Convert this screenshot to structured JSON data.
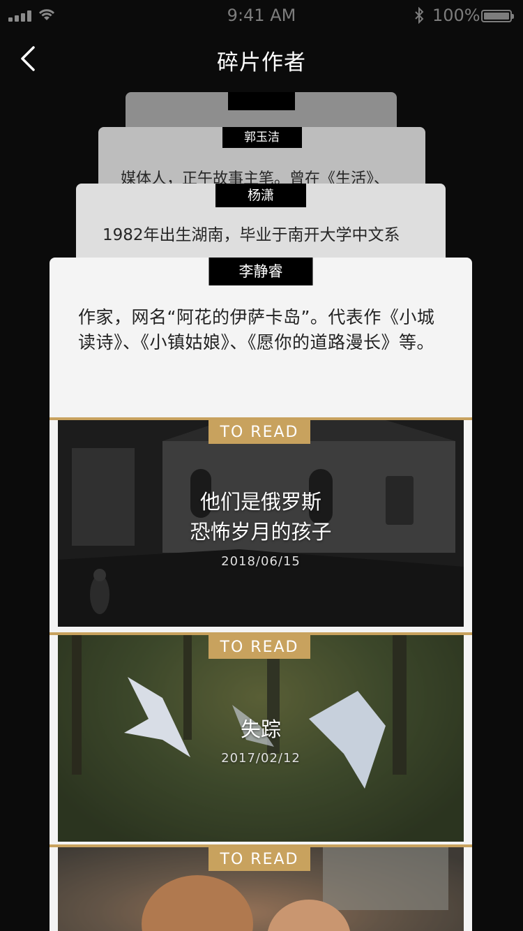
{
  "status_bar": {
    "time": "9:41 AM",
    "battery_percent": "100%",
    "signal_bars": 4,
    "battery_level": 1.0
  },
  "nav": {
    "title": "碎片作者",
    "back_icon": "chevron-left-icon"
  },
  "authors": [
    {
      "name": "",
      "bio": ""
    },
    {
      "name": "郭玉洁",
      "bio": "媒体人，正午故事主笔。曾在《生活》、"
    },
    {
      "name": "杨潇",
      "bio": "1982年出生湖南，毕业于南开大学中文系"
    },
    {
      "name": "李静睿",
      "bio": "作家，网名“阿花的伊萨卡岛”。代表作《小城读诗》、《小镇姑娘》、《愿你的道路漫长》等。"
    }
  ],
  "articles": [
    {
      "badge": "TO READ",
      "title_line1": "他们是俄罗斯",
      "title_line2": "恐怖岁月的孩子",
      "date": "2018/06/15"
    },
    {
      "badge": "TO READ",
      "title_line1": "失踪",
      "title_line2": "",
      "date": "2017/02/12"
    },
    {
      "badge": "TO READ",
      "title_line1": "",
      "title_line2": "",
      "date": ""
    }
  ],
  "colors": {
    "background": "#0b0b0b",
    "accent": "#c8a25e",
    "card": "#f4f4f4"
  }
}
